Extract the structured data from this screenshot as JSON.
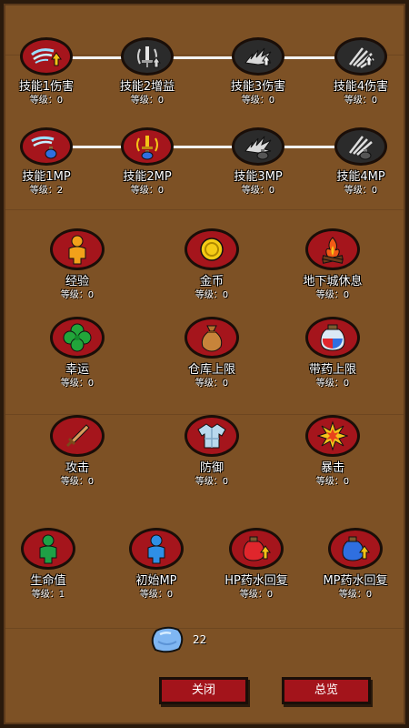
{
  "skills_row1": [
    {
      "name": "技能1伤害",
      "level_label": "等级：0",
      "icon": "wind-slash-up-icon",
      "state": "active"
    },
    {
      "name": "技能2增益",
      "level_label": "等级：0",
      "icon": "sword-buff-icon",
      "state": "locked"
    },
    {
      "name": "技能3伤害",
      "level_label": "等级：0",
      "icon": "spiky-burst-icon",
      "state": "locked"
    },
    {
      "name": "技能4伤害",
      "level_label": "等级：0",
      "icon": "claw-burst-icon",
      "state": "locked"
    }
  ],
  "skills_row2": [
    {
      "name": "技能1MP",
      "level_label": "等级：2",
      "icon": "wind-potion-icon",
      "state": "active"
    },
    {
      "name": "技能2MP",
      "level_label": "等级：0",
      "icon": "sword-potion-icon",
      "state": "active"
    },
    {
      "name": "技能3MP",
      "level_label": "等级：0",
      "icon": "spiky-potion-icon",
      "state": "locked"
    },
    {
      "name": "技能4MP",
      "level_label": "等级：0",
      "icon": "claw-potion-icon",
      "state": "locked"
    }
  ],
  "attrs_row1": [
    {
      "name": "经验",
      "level_label": "等级：0",
      "icon": "person-icon"
    },
    {
      "name": "金币",
      "level_label": "等级：0",
      "icon": "gold-coin-icon"
    },
    {
      "name": "地下城休息",
      "level_label": "等级：0",
      "icon": "campfire-icon"
    }
  ],
  "attrs_row2": [
    {
      "name": "幸运",
      "level_label": "等级：0",
      "icon": "clover-icon"
    },
    {
      "name": "仓库上限",
      "level_label": "等级：0",
      "icon": "sack-icon"
    },
    {
      "name": "带药上限",
      "level_label": "等级：0",
      "icon": "potion-jar-icon"
    }
  ],
  "attrs_row3": [
    {
      "name": "攻击",
      "level_label": "等级：0",
      "icon": "sword-icon"
    },
    {
      "name": "防御",
      "level_label": "等级：0",
      "icon": "armor-icon"
    },
    {
      "name": "暴击",
      "level_label": "等级：0",
      "icon": "explosion-icon"
    }
  ],
  "attrs_row4": [
    {
      "name": "生命值",
      "level_label": "等级：1",
      "icon": "green-person-icon"
    },
    {
      "name": "初始MP",
      "level_label": "等级：0",
      "icon": "blue-person-icon"
    },
    {
      "name": "HP药水回复",
      "level_label": "等级：0",
      "icon": "hp-potion-up-icon"
    },
    {
      "name": "MP药水回复",
      "level_label": "等级：0",
      "icon": "mp-potion-up-icon"
    }
  ],
  "currency": {
    "icon": "blue-gem-icon",
    "count": "22"
  },
  "buttons": {
    "close": "关闭",
    "overview": "总览"
  },
  "colors": {
    "board": "#7d5125",
    "active_circle": "#a5151c",
    "locked_circle": "#2b2b2b",
    "connector": "#f2f2f2"
  }
}
